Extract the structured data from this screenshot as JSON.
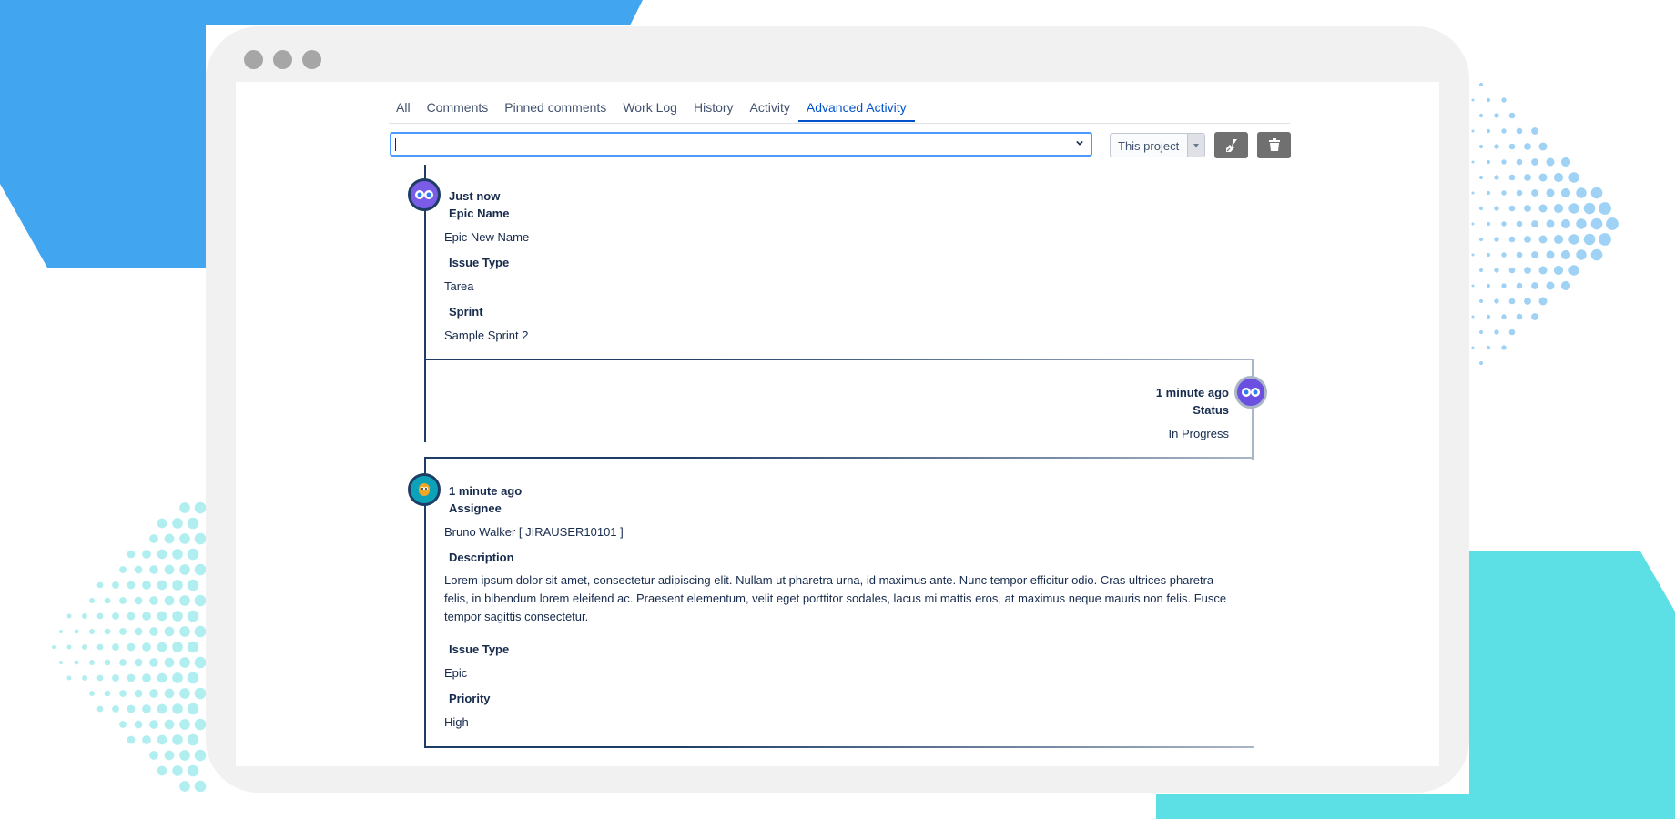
{
  "tabs": [
    {
      "label": "All"
    },
    {
      "label": "Comments"
    },
    {
      "label": "Pinned comments"
    },
    {
      "label": "Work Log"
    },
    {
      "label": "History"
    },
    {
      "label": "Activity"
    },
    {
      "label": "Advanced Activity"
    }
  ],
  "active_tab": "Advanced Activity",
  "filter": {
    "value": "",
    "project_select": "This project"
  },
  "actions": {
    "clean_icon": "broom-icon",
    "delete_icon": "trash-icon"
  },
  "colors": {
    "accent": "#0052cc",
    "timeline": "#1e3d66",
    "background_blue": "#42a5f0",
    "background_cyan": "#5ce0e6"
  },
  "entries": [
    {
      "time": "Just now",
      "fields": [
        {
          "name": "Epic Name",
          "value": "Epic New Name"
        },
        {
          "name": "Issue Type",
          "value": "Tarea"
        },
        {
          "name": "Sprint",
          "value": "Sample Sprint 2"
        }
      ]
    },
    {
      "time": "1 minute ago",
      "fields": [
        {
          "name": "Status",
          "value": "In Progress"
        }
      ]
    },
    {
      "time": "1 minute ago",
      "fields": [
        {
          "name": "Assignee",
          "value": "Bruno Walker [ JIRAUSER10101 ]"
        },
        {
          "name": "Description",
          "value": "Lorem ipsum dolor sit amet, consectetur adipiscing elit. Nullam ut pharetra urna, id maximus ante. Nunc tempor efficitur odio. Cras ultrices pharetra felis, in bibendum lorem eleifend ac. Praesent elementum, velit eget porttitor sodales, lacus mi mattis eros, at maximus neque mauris non felis. Fusce tempor sagittis consectetur."
        },
        {
          "name": "Issue Type",
          "value": "Epic"
        },
        {
          "name": "Priority",
          "value": "High"
        }
      ]
    }
  ]
}
